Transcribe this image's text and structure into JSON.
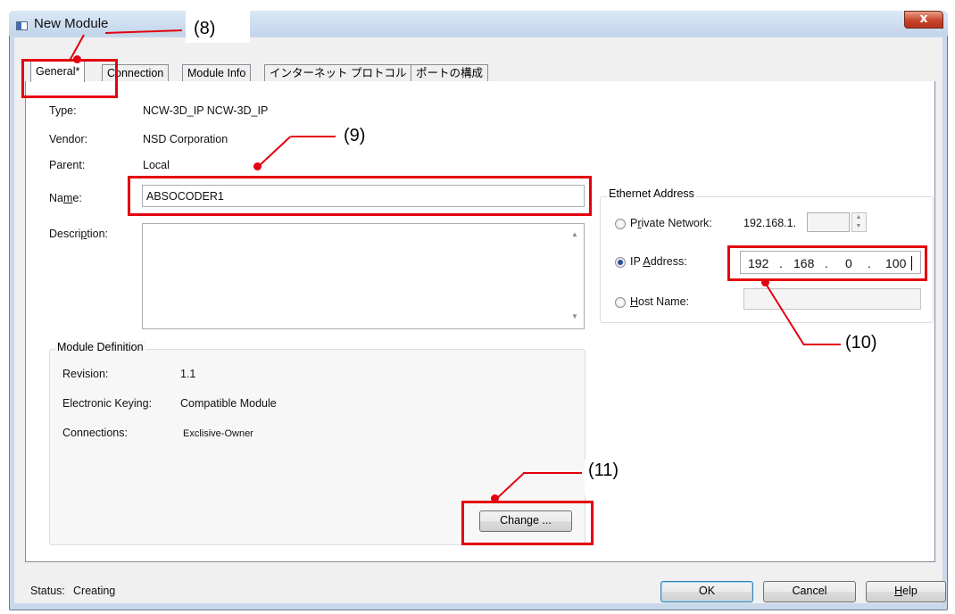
{
  "window": {
    "title": "New Module",
    "close_glyph": "x"
  },
  "tabs": [
    {
      "label": "General*",
      "active": true
    },
    {
      "label": "Connection",
      "active": false
    },
    {
      "label": "Module Info",
      "active": false
    },
    {
      "label": "インターネット プロトコル",
      "active": false
    },
    {
      "label": "ポートの構成",
      "active": false
    }
  ],
  "general": {
    "type_label": "Type:",
    "type_value": "NCW-3D_IP NCW-3D_IP",
    "vendor_label": "Vendor:",
    "vendor_value": "NSD Corporation",
    "parent_label": "Parent:",
    "parent_value": "Local",
    "name_label_pre": "Na",
    "name_label_ul": "m",
    "name_label_post": "e:",
    "name_value": "ABSOCODER1",
    "desc_label_pre": "Descri",
    "desc_label_ul": "p",
    "desc_label_post": "tion:",
    "desc_value": ""
  },
  "ethernet": {
    "title": "Ethernet Address",
    "private_label_pre": "P",
    "private_label_ul": "r",
    "private_label_post": "ivate Network:",
    "private_prefix": "192.168.1.",
    "private_value": "",
    "ip_label_pre": "IP ",
    "ip_label_ul": "A",
    "ip_label_post": "ddress:",
    "ip_octets": [
      "192",
      "168",
      "0",
      "100"
    ],
    "ip_dot": ".",
    "host_label_ul": "H",
    "host_label_post": "ost Name:",
    "host_value": "",
    "selected": "ip"
  },
  "module_definition": {
    "title": "Module Definition",
    "revision_label": "Revision:",
    "revision_value": "1.1",
    "keying_label": "Electronic Keying:",
    "keying_value": "Compatible Module",
    "connections_label": "Connections:",
    "connections_value": "Exclisive-Owner",
    "change_button": "Change ..."
  },
  "footer": {
    "status_label": "Status:",
    "status_value": "Creating",
    "ok": "OK",
    "cancel": "Cancel",
    "help_ul": "H",
    "help_post": "elp"
  },
  "annotations": [
    "(8)",
    "(9)",
    "(10)",
    "(11)"
  ],
  "colors": {
    "annotation": "#e3000f",
    "title_bar": "#c9d8ea",
    "close_button": "#c8442a"
  }
}
